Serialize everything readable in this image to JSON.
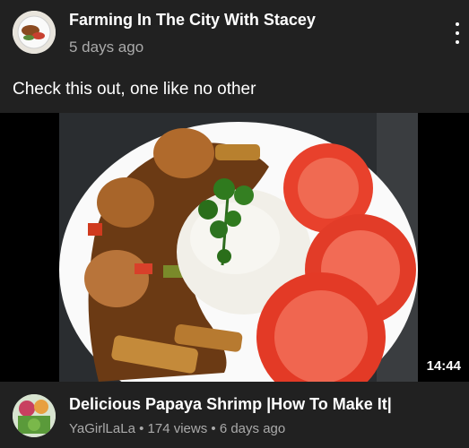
{
  "post": {
    "channel_name": "Farming In The City With Stacey",
    "time": "5 days ago",
    "text": "Check this out, one like no other",
    "more_icon": "more-vertical-icon"
  },
  "video": {
    "duration": "14:44",
    "title": "Delicious Papaya Shrimp |How To Make It|",
    "channel": "YaGirlLaLa",
    "views": "174 views",
    "age": "6 days ago",
    "separator": " • "
  },
  "colors": {
    "background": "#212121",
    "secondary_text": "#aaaaaa",
    "video_bg": "#000000"
  }
}
